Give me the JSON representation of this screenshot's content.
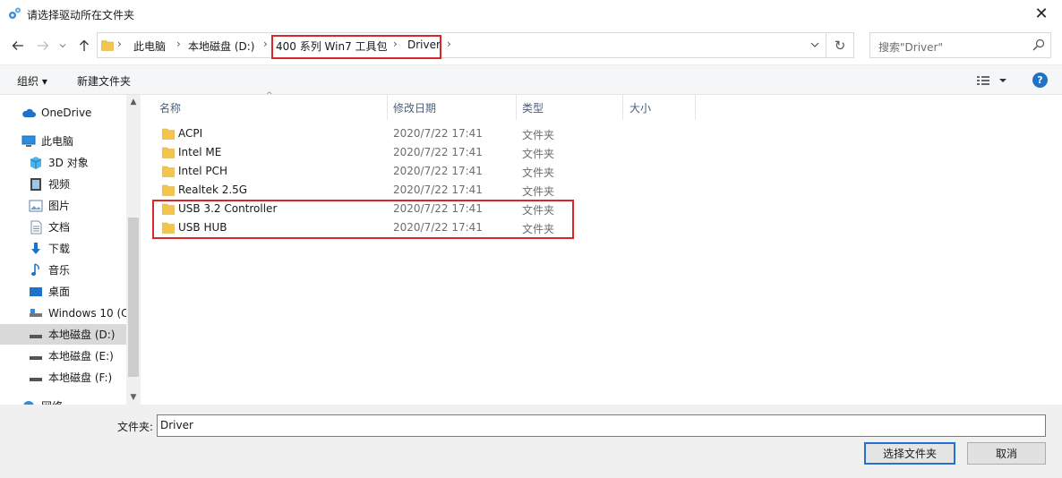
{
  "window": {
    "title": "请选择驱动所在文件夹",
    "close": "✕"
  },
  "address": {
    "crumbs": [
      "此电脑",
      "本地磁盘 (D:)",
      "400 系列 Win7 工具包",
      "Driver"
    ],
    "search_placeholder": "搜索\"Driver\""
  },
  "toolbar": {
    "organize": "组织 ▾",
    "new_folder": "新建文件夹"
  },
  "nav": {
    "items": [
      {
        "label": "OneDrive",
        "icon": "cloud-icon"
      },
      {
        "label": "此电脑",
        "icon": "computer-icon"
      },
      {
        "label": "3D 对象",
        "icon": "cube-icon"
      },
      {
        "label": "视频",
        "icon": "video-icon"
      },
      {
        "label": "图片",
        "icon": "picture-icon"
      },
      {
        "label": "文档",
        "icon": "document-icon"
      },
      {
        "label": "下载",
        "icon": "download-icon"
      },
      {
        "label": "音乐",
        "icon": "music-icon"
      },
      {
        "label": "桌面",
        "icon": "desktop-icon"
      },
      {
        "label": "Windows 10 (C",
        "icon": "drive-icon"
      },
      {
        "label": "本地磁盘 (D:)",
        "icon": "drive-icon",
        "selected": true
      },
      {
        "label": "本地磁盘 (E:)",
        "icon": "drive-icon"
      },
      {
        "label": "本地磁盘 (F:)",
        "icon": "drive-icon"
      },
      {
        "label": "网络",
        "icon": "network-icon"
      }
    ]
  },
  "columns": {
    "name": "名称",
    "date": "修改日期",
    "type": "类型",
    "size": "大小"
  },
  "files": [
    {
      "name": "ACPI",
      "date": "2020/7/22 17:41",
      "type": "文件夹"
    },
    {
      "name": "Intel ME",
      "date": "2020/7/22 17:41",
      "type": "文件夹"
    },
    {
      "name": "Intel PCH",
      "date": "2020/7/22 17:41",
      "type": "文件夹"
    },
    {
      "name": "Realtek 2.5G",
      "date": "2020/7/22 17:41",
      "type": "文件夹"
    },
    {
      "name": "USB 3.2 Controller",
      "date": "2020/7/22 17:41",
      "type": "文件夹"
    },
    {
      "name": "USB HUB",
      "date": "2020/7/22 17:41",
      "type": "文件夹"
    }
  ],
  "bottom": {
    "folder_label": "文件夹:",
    "folder_value": "Driver",
    "select_button": "选择文件夹",
    "cancel_button": "取消"
  },
  "colors": {
    "highlight": "#d9262b",
    "folder": "#f3c54c",
    "accent": "#1e72c8"
  }
}
